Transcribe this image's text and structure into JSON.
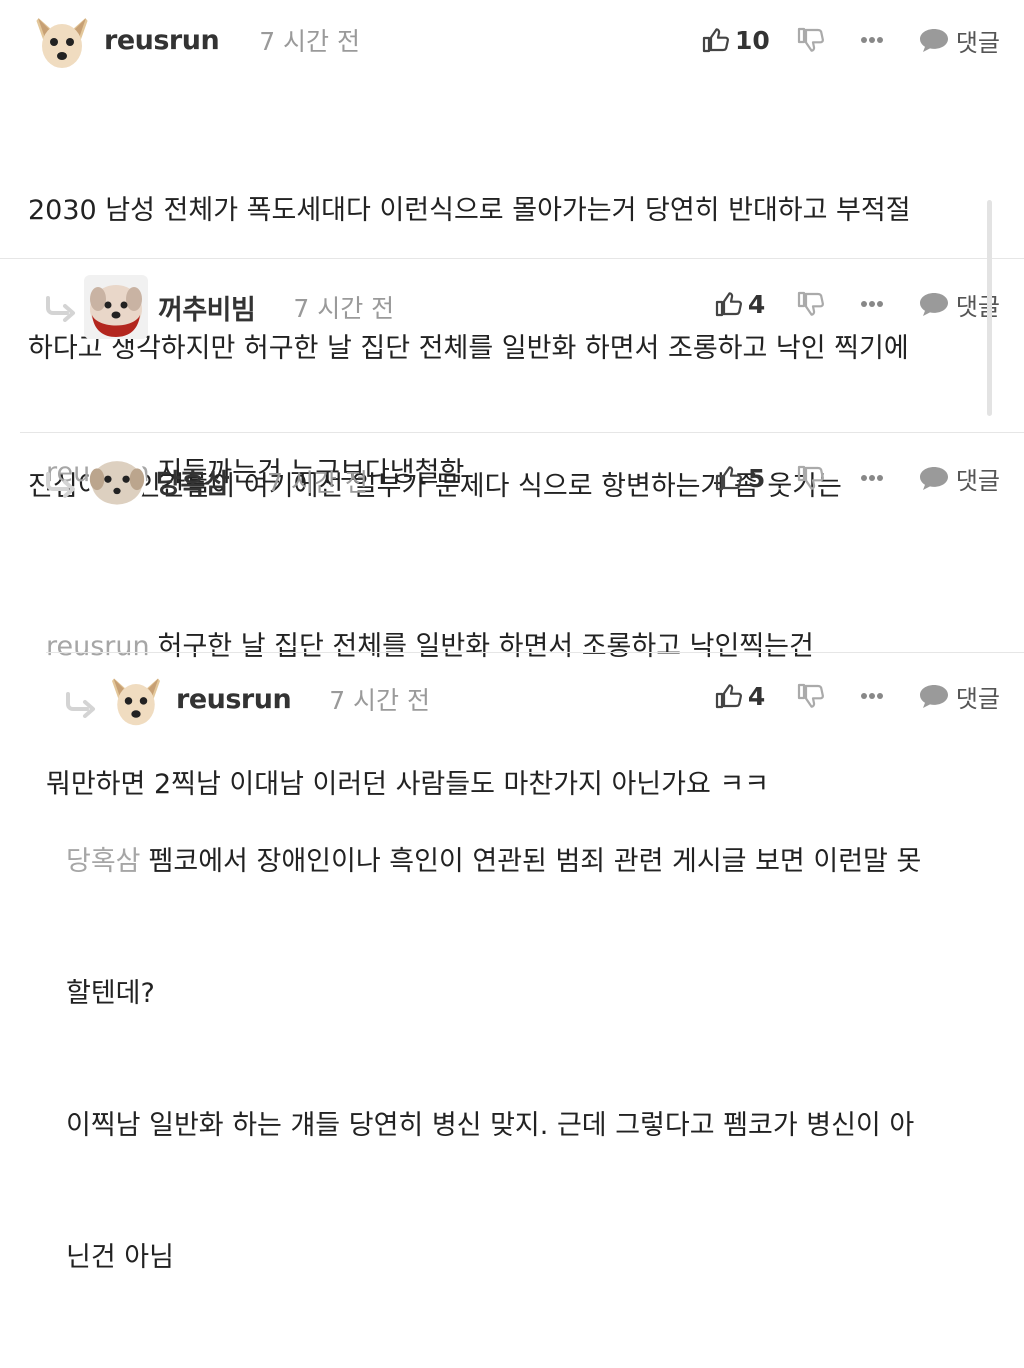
{
  "comments": [
    {
      "nickname": "reusrun",
      "time": "7 시간 전",
      "likes": "10",
      "reply_label": "댓글",
      "body_lines": [
        "2030 남성 전체가 폭도세대다 이런식으로 몰아가는거 당연히 반대하고 부적절",
        "하다고 생각하지만 허구한 날 집단 전체를 일반화 하면서 조롱하고 낙인 찍기에",
        "진심이던 인간들이 여기에선 일부가 문제다 식으로 항변하는거 좀 웃기는"
      ]
    },
    {
      "nickname": "꺼추비빔",
      "time": "7 시간 전",
      "likes": "4",
      "reply_label": "댓글",
      "mention": "reusrun",
      "body_lines": [
        "지들까는건 누구보다냉철함"
      ]
    },
    {
      "nickname": "당혹삼",
      "time": "7 시간 전",
      "likes": "5",
      "reply_label": "댓글",
      "mention": "reusrun",
      "body_lines": [
        "허구한 날 집단 전체를 일반화 하면서 조롱하고 낙인찍는건",
        "뭐만하면 2찍남 이대남 이러던 사람들도 마찬가지 아닌가요 ㅋㅋ"
      ]
    },
    {
      "nickname": "reusrun",
      "time": "7 시간 전",
      "likes": "4",
      "reply_label": "댓글",
      "mention": "당혹삼",
      "body_lines": [
        "펨코에서 장애인이나 흑인이 연관된 범죄 관련 게시글 보면 이런말 못",
        "할텐데?",
        "이찍남 일반화 하는 걔들 당연히 병신 맞지. 근데 그렇다고 펨코가 병신이 아",
        "닌건 아님"
      ]
    }
  ],
  "icons": {
    "like": "thumbs-up-icon",
    "dislike": "thumbs-down-icon",
    "more": "more-dots-icon",
    "reply": "speech-bubble-icon",
    "reply_arrow": "reply-arrow-icon"
  },
  "colors": {
    "text": "#222222",
    "muted": "#9a9a9a",
    "mention": "#a6a6a6",
    "divider": "#e6e6e6"
  }
}
